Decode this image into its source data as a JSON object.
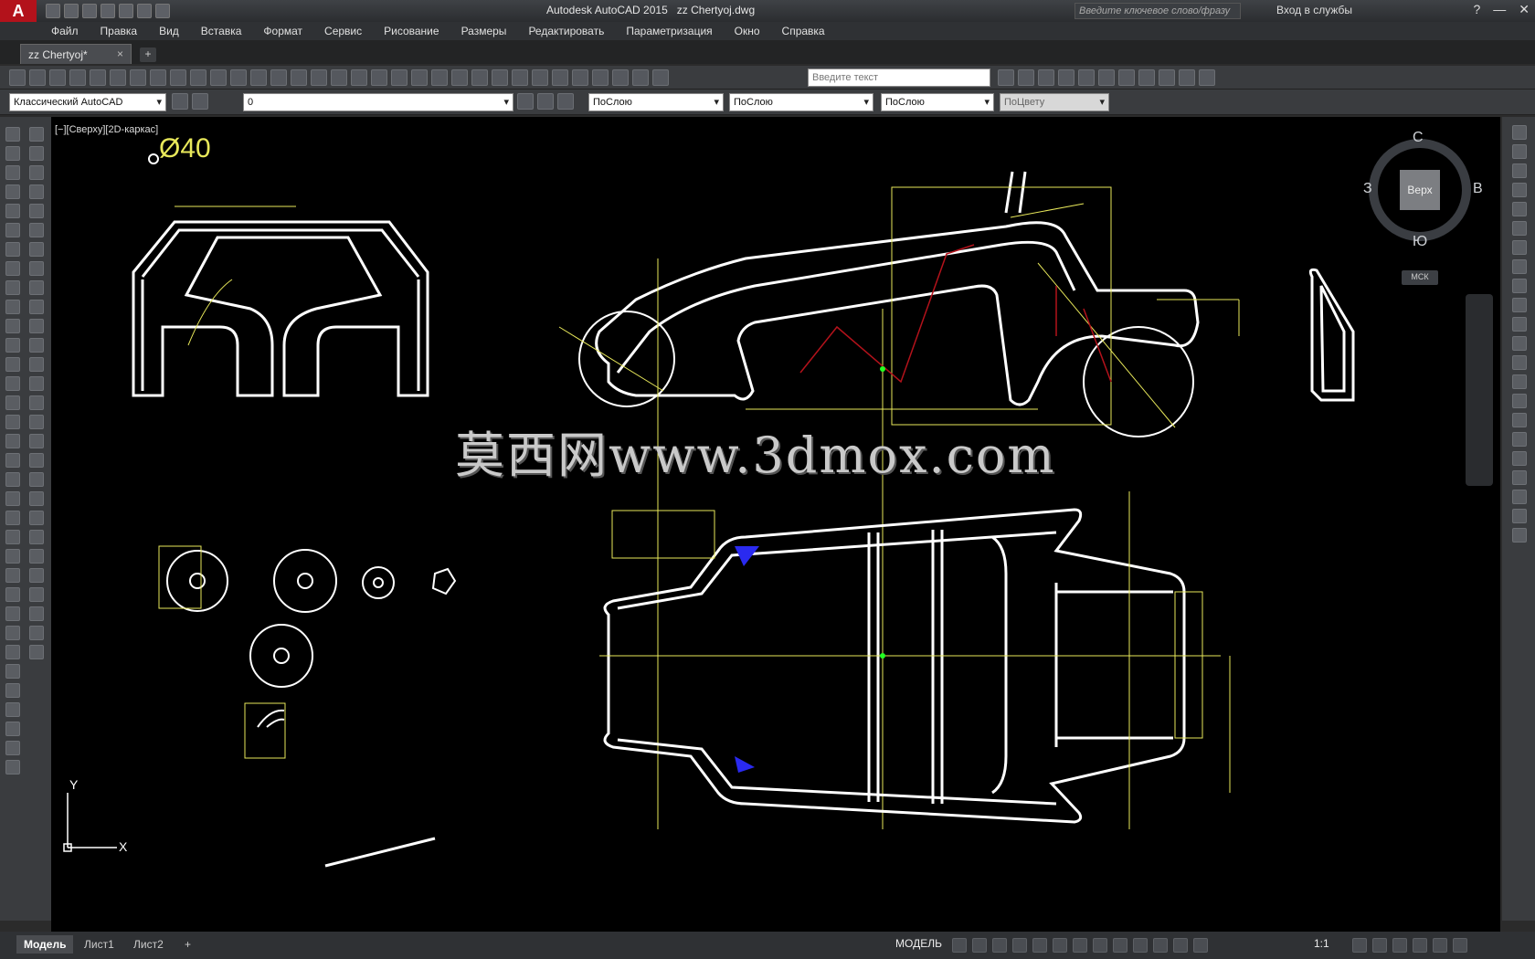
{
  "titlebar": {
    "app_name": "Autodesk AutoCAD 2015",
    "file_name": "zz Chertyoj.dwg",
    "search_placeholder": "Введите ключевое слово/фразу",
    "signin_label": "Вход в службы"
  },
  "menu": [
    "Файл",
    "Правка",
    "Вид",
    "Вставка",
    "Формат",
    "Сервис",
    "Рисование",
    "Размеры",
    "Редактировать",
    "Параметризация",
    "Окно",
    "Справка"
  ],
  "document_tab": {
    "label": "zz Chertyoj*",
    "close": "×",
    "new": "+"
  },
  "toolbar": {
    "text_input_placeholder": "Введите текст",
    "workspace": "Классический AutoCAD",
    "layer": "0",
    "color": "ПоСлою",
    "linetype": "ПоСлою",
    "lineweight": "ПоСлою",
    "plotstyle": "ПоЦвету"
  },
  "viewport": {
    "label": "[−][Сверху][2D-каркас]",
    "dimension_text": "Ø40",
    "watermark": "莫西网www.3dmox.com"
  },
  "viewcube": {
    "face": "Верх",
    "north": "С",
    "south": "Ю",
    "west": "З",
    "east": "В",
    "ucs": "МСК"
  },
  "ucs_axes": {
    "x": "X",
    "y": "Y"
  },
  "statusbar": {
    "tabs": [
      "Модель",
      "Лист1",
      "Лист2"
    ],
    "add_tab": "+",
    "model_button": "МОДЕЛЬ",
    "scale": "1:1"
  },
  "colors": {
    "accent": "#b3121b",
    "dimension": "#e8e85a",
    "geometry": "#ffffff"
  }
}
